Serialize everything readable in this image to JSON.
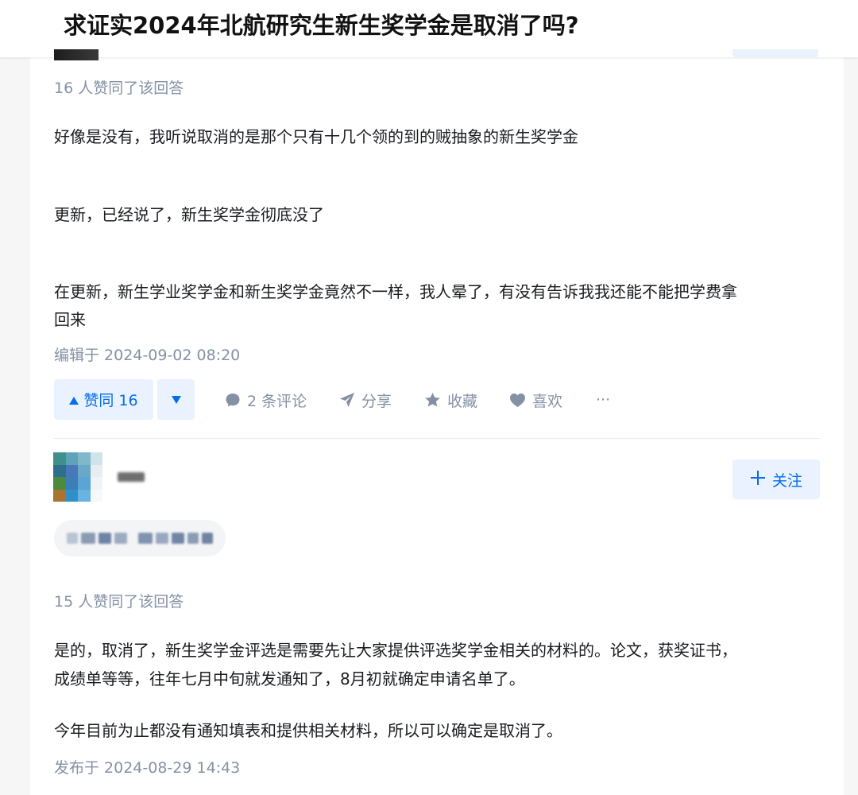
{
  "question": {
    "title": "求证实2024年北航研究生新生奖学金是取消了吗?"
  },
  "answers": [
    {
      "upvote_note": "16 人赞同了该回答",
      "paragraphs": [
        "好像是没有，我听说取消的是那个只有十几个领的到的贼抽象的新生奖学金",
        "更新，已经说了，新生奖学金彻底没了",
        "在更新，新生学业奖学金和新生奖学金竟然不一样，我人晕了，有没有告诉我我还能不能把学费拿",
        "回来"
      ],
      "timestamp": "编辑于 2024-09-02 08:20",
      "actions": {
        "vote_up": "赞同 16",
        "comments": "2 条评论",
        "share": "分享",
        "collect": "收藏",
        "like": "喜欢",
        "more": "···"
      }
    },
    {
      "author": {
        "follow": "关注"
      },
      "upvote_note": "15 人赞同了该回答",
      "paragraphs": [
        "是的，取消了，新生奖学金评选是需要先让大家提供评选奖学金相关的材料的。论文，获奖证书，",
        "成绩单等等，往年七月中旬就发通知了，8月初就确定申请名单了。",
        "今年目前为止都没有通知填表和提供相关材料，所以可以确定是取消了。"
      ],
      "timestamp": "发布于 2024-08-29 14:43"
    }
  ],
  "colors": {
    "accent": "#056de8",
    "accent_bg": "#eaf2ff",
    "meta": "#8491a5",
    "text": "#191b1f"
  },
  "icons": [
    "triangle-up-icon",
    "triangle-down-icon",
    "comment-icon",
    "share-icon",
    "star-icon",
    "heart-icon",
    "plus-icon"
  ]
}
